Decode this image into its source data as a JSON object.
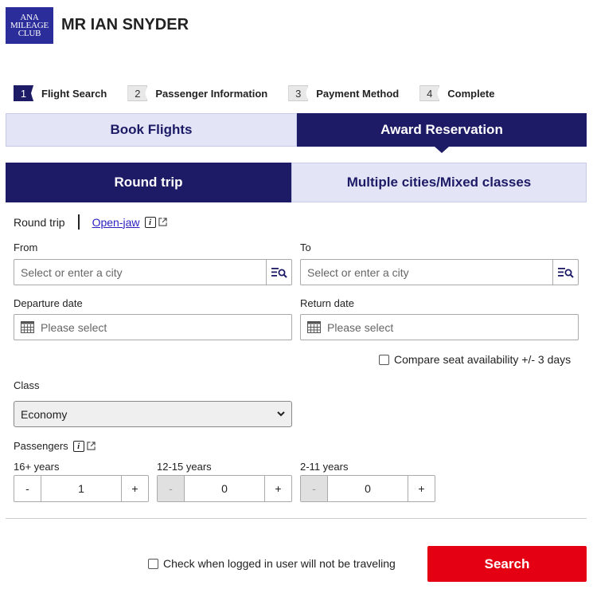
{
  "header": {
    "logo_lines": [
      "ANA",
      "MILEAGE",
      "CLUB"
    ],
    "user_name": "MR IAN SNYDER"
  },
  "steps": [
    {
      "num": "1",
      "label": "Flight Search",
      "active": true
    },
    {
      "num": "2",
      "label": "Passenger Information",
      "active": false
    },
    {
      "num": "3",
      "label": "Payment Method",
      "active": false
    },
    {
      "num": "4",
      "label": "Complete",
      "active": false
    }
  ],
  "booking_tabs": {
    "book_flights": "Book Flights",
    "award_reservation": "Award Reservation"
  },
  "trip_tabs": {
    "round_trip": "Round trip",
    "multi_city": "Multiple cities/Mixed classes"
  },
  "trip_type": {
    "current": "Round trip",
    "open_jaw_link": "Open-jaw"
  },
  "from": {
    "label": "From",
    "placeholder": "Select or enter a city"
  },
  "to": {
    "label": "To",
    "placeholder": "Select or enter a city"
  },
  "departure": {
    "label": "Departure date",
    "placeholder": "Please select"
  },
  "return": {
    "label": "Return date",
    "placeholder": "Please select"
  },
  "compare_label": "Compare seat availability +/- 3 days",
  "class": {
    "label": "Class",
    "selected": "Economy"
  },
  "passengers": {
    "label": "Passengers",
    "groups": [
      {
        "label": "16+ years",
        "value": "1",
        "minus": "-",
        "plus": "+"
      },
      {
        "label": "12-15 years",
        "value": "0",
        "minus": "-",
        "plus": "+"
      },
      {
        "label": "2-11 years",
        "value": "0",
        "minus": "-",
        "plus": "+"
      }
    ]
  },
  "not_traveling_label": "Check when logged in user will not be traveling",
  "search_button": "Search"
}
